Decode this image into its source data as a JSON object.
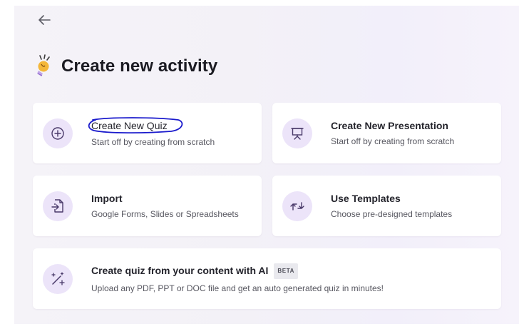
{
  "page": {
    "title": "Create new activity",
    "back_icon": "arrow-left-icon",
    "title_icon": "lightbulb-icon"
  },
  "cards": {
    "quiz": {
      "title": "Create New Quiz",
      "subtitle": "Start off by creating from scratch",
      "icon": "plus-circle-icon",
      "annotation_color": "#1a1acc"
    },
    "presentation": {
      "title": "Create New Presentation",
      "subtitle": "Start off by creating from scratch",
      "icon": "presentation-board-icon"
    },
    "import": {
      "title": "Import",
      "subtitle": "Google Forms, Slides or Spreadsheets",
      "icon": "file-import-icon"
    },
    "templates": {
      "title": "Use Templates",
      "subtitle": "Choose pre-designed templates",
      "icon": "swap-arrows-icon"
    },
    "ai": {
      "title": "Create quiz from your content with AI",
      "badge": "BETA",
      "subtitle": "Upload any PDF, PPT or DOC file and get an auto generated quiz in minutes!",
      "icon": "magic-wand-icon"
    }
  },
  "colors": {
    "icon_bg": "#ece4f9",
    "icon_stroke": "#5b3b93",
    "title_text": "#1b1b22"
  }
}
